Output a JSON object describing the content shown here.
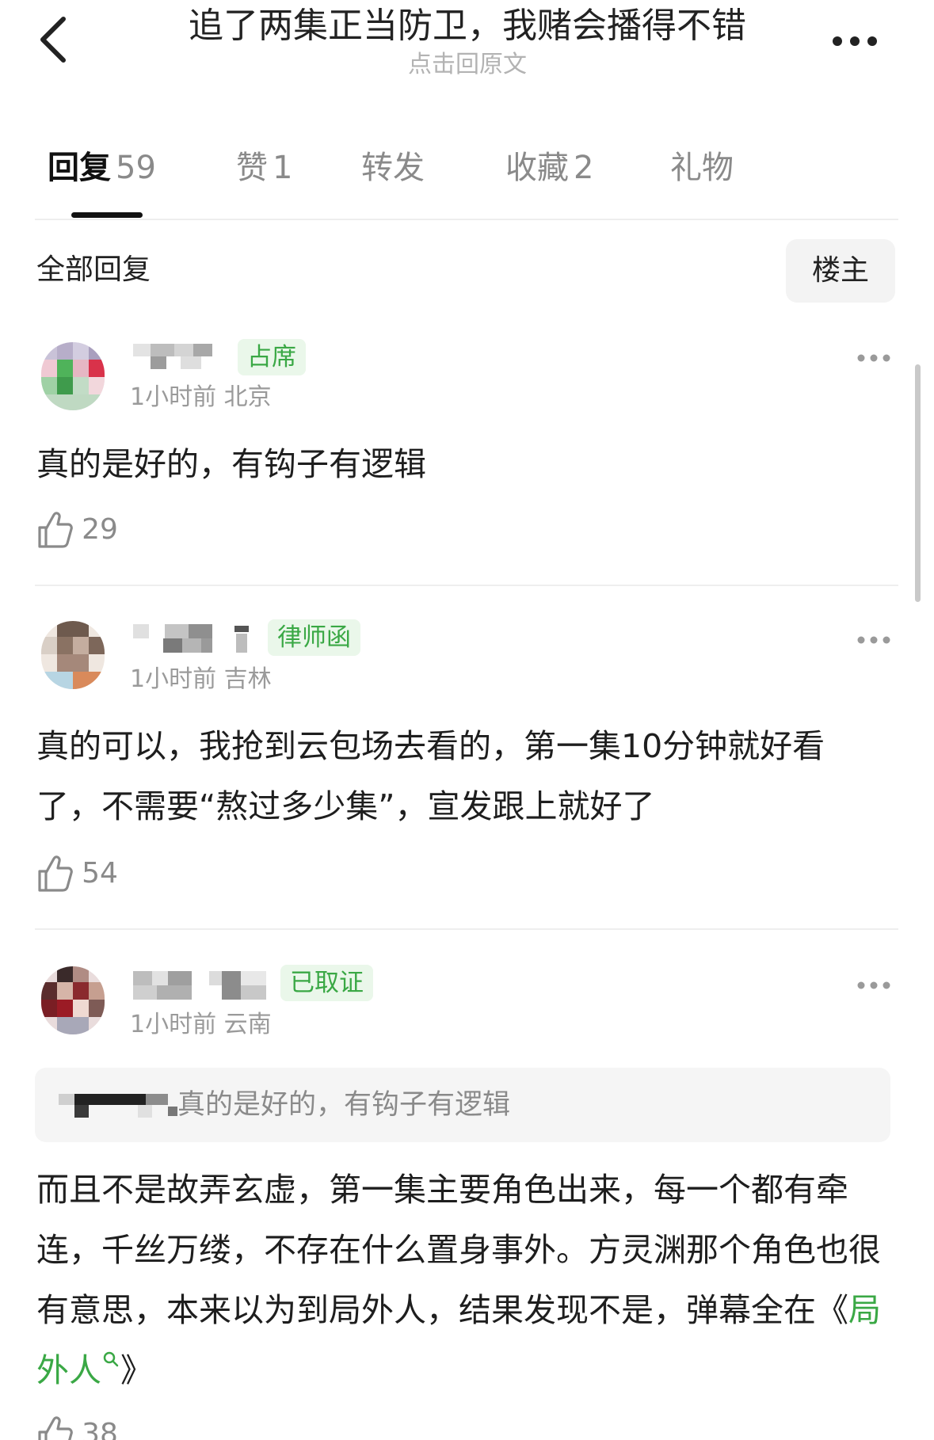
{
  "header": {
    "title": "追了两集正当防卫，我赌会播得不错",
    "subtitle": "点击回原文"
  },
  "tabs": [
    {
      "label": "回复",
      "count": "59"
    },
    {
      "label": "赞",
      "count": "1"
    },
    {
      "label": "转发",
      "count": ""
    },
    {
      "label": "收藏",
      "count": "2"
    },
    {
      "label": "礼物",
      "count": ""
    }
  ],
  "section": {
    "title": "全部回复",
    "filter_label": "楼主"
  },
  "comments": [
    {
      "badge": "占席",
      "meta": "1小时前 北京",
      "content": "真的是好的，有钩子有逻辑",
      "likes": "29"
    },
    {
      "badge": "律师函",
      "meta": "1小时前 吉林",
      "content": "真的可以，我抢到云包场去看的，第一集10分钟就好看了，不需要“熬过多少集”，宣发跟上就好了",
      "likes": "54"
    },
    {
      "badge": "已取证",
      "meta": "1小时前 云南",
      "quote_text": "真的是好的，有钩子有逻辑",
      "content": "而且不是故弄玄虚，第一集主要角色出来，每一个都有牵连，千丝万缕，不存在什么置身事外。方灵渊那个角色也很有意思，本来以为到局外人，结果发现不是，弹幕全在《",
      "link_text": "局外人",
      "content_end": "》",
      "likes": "38"
    }
  ],
  "icons": {
    "back": "chevron-left-icon",
    "more": "more-dots-icon",
    "like": "thumbs-up-icon",
    "search": "search-icon"
  },
  "colors": {
    "badge_green": "#3aa845",
    "badge_bg": "#eaf7ea",
    "link_green": "#3aa845"
  }
}
